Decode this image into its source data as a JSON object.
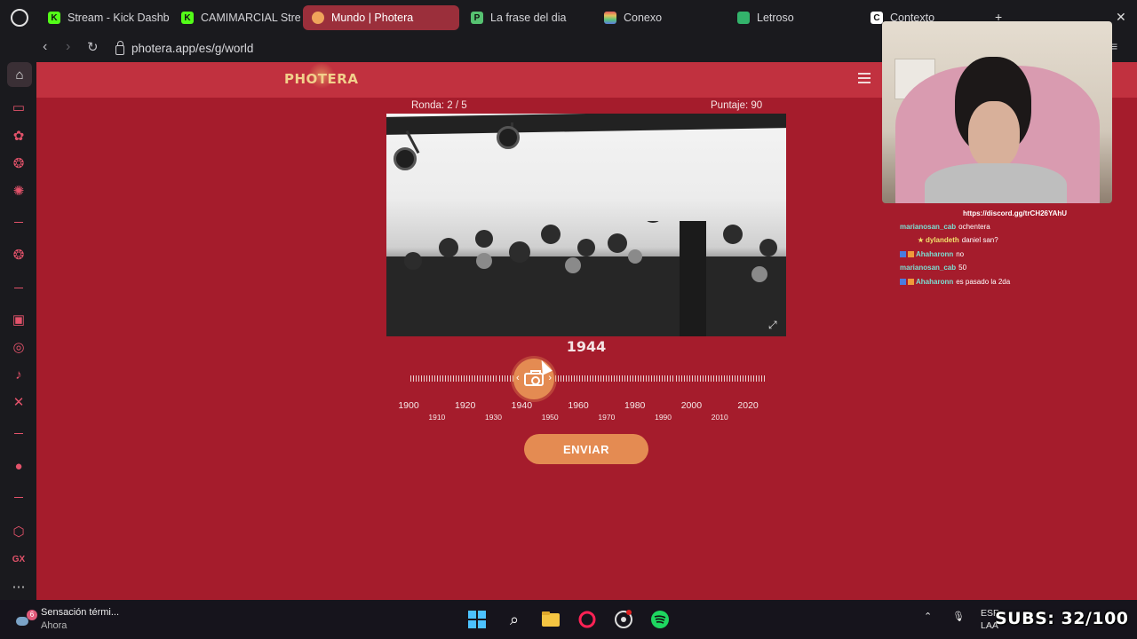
{
  "browser": {
    "tabs": [
      {
        "label": "Stream - Kick Dashb",
        "icon": "kick-icon",
        "color": "#53fc18"
      },
      {
        "label": "CAMIMARCIAL Strea",
        "icon": "kick-icon",
        "color": "#53fc18"
      },
      {
        "label": "Mundo | Photera",
        "icon": "photera-icon",
        "color": "#f0a45b",
        "active": true
      },
      {
        "label": "La frase del dia",
        "icon": "frase-icon",
        "color": "#56c271"
      },
      {
        "label": "Conexo",
        "icon": "conexo-icon",
        "color": "#a978e2"
      },
      {
        "label": "Letroso",
        "icon": "letroso-icon",
        "color": "#33b36b"
      },
      {
        "label": "Contexto",
        "icon": "contexto-icon",
        "color": "#ffffff"
      }
    ],
    "url": "photera.app/es/g/world",
    "new_tab": "+"
  },
  "photera": {
    "logo": "PHOTERA",
    "round": "Ronda: 2 / 5",
    "score": "Puntaje: 90",
    "year": "1944",
    "submit_label": "ENVIAR",
    "slider_value": 1944,
    "slider_range": [
      1900,
      2025
    ],
    "major_labels": [
      "1900",
      "1920",
      "1940",
      "1960",
      "1980",
      "2000",
      "2020"
    ],
    "minor_labels": [
      "1910",
      "1930",
      "1950",
      "1970",
      "1990",
      "2010"
    ],
    "photo_description_icon": "historical-photo"
  },
  "stream_overlay": {
    "discord": "https://discord.gg/trCH26YAhU",
    "chat": [
      {
        "user": "marianosan_cab",
        "message": "ochentera",
        "badge": "none",
        "color": "#7be0d4"
      },
      {
        "user": "dylandeth",
        "message": "daniel san?",
        "badge": "star",
        "color": "#f1e06b"
      },
      {
        "user": "Ahaharonn",
        "message": "no",
        "badge": "mod",
        "color": "#7be0d4"
      },
      {
        "user": "marianosan_cab",
        "message": "50",
        "badge": "none",
        "color": "#7be0d4"
      },
      {
        "user": "Ahaharonn",
        "message": "es pasado la 2da",
        "badge": "mod",
        "color": "#7be0d4"
      }
    ],
    "subs": "SUBS: 32/100"
  },
  "taskbar": {
    "weather_title": "Sensación térmi...",
    "weather_sub": "Ahora",
    "weather_badge": "6",
    "lang_top": "ESP",
    "lang_bottom": "LAA"
  },
  "colors": {
    "page_bg": "#a51c2c",
    "header_bg": "#c1313f",
    "accent": "#e48b52"
  }
}
